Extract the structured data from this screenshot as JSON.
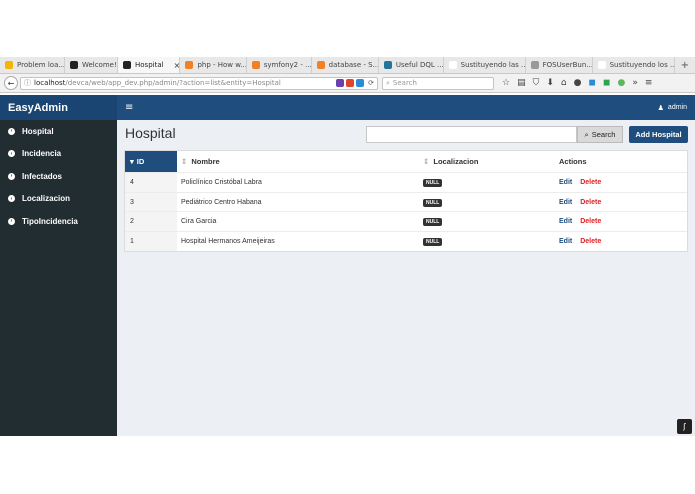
{
  "browser": {
    "tabs": [
      {
        "label": "Problem loa...",
        "color": "#f4b400",
        "active": false
      },
      {
        "label": "Welcome!",
        "color": "#222222",
        "active": false
      },
      {
        "label": "Hospital",
        "color": "#222222",
        "active": true
      },
      {
        "label": "php - How w...",
        "color": "#f48024",
        "active": false
      },
      {
        "label": "symfony2 - ...",
        "color": "#f48024",
        "active": false
      },
      {
        "label": "database - S...",
        "color": "#f48024",
        "active": false
      },
      {
        "label": "Useful DQL ...",
        "color": "#21759b",
        "active": false
      },
      {
        "label": "Sustituyendo las ...",
        "color": "#ffffff",
        "active": false
      },
      {
        "label": "FOSUserBun...",
        "color": "#999999",
        "active": false
      },
      {
        "label": "Sustituyendo los ...",
        "color": "#ffffff",
        "active": false
      }
    ],
    "new_tab": "+",
    "tab_close": "×",
    "url_host": "localhost",
    "url_path": "/devca/web/app_dev.php/admin/?action=list&entity=Hospital",
    "search_placeholder": "Search"
  },
  "header": {
    "logo": "EasyAdmin",
    "toggle": "≡",
    "user": "admin"
  },
  "sidebar": {
    "items": [
      {
        "label": "Hospital"
      },
      {
        "label": "Incidencia"
      },
      {
        "label": "Infectados"
      },
      {
        "label": "Localizacion"
      },
      {
        "label": "TipoIncidencia"
      }
    ]
  },
  "main": {
    "title": "Hospital",
    "search_button": "Search",
    "add_button": "Add Hospital",
    "columns": {
      "id": "ID",
      "nombre": "Nombre",
      "localizacion": "Localizacion",
      "actions": "Actions"
    },
    "rows": [
      {
        "id": "4",
        "nombre": "Policlínico Cristóbal Labra",
        "localizacion": "NULL"
      },
      {
        "id": "3",
        "nombre": "Pediátrico Centro Habana",
        "localizacion": "NULL"
      },
      {
        "id": "2",
        "nombre": "Cira Garcia",
        "localizacion": "NULL"
      },
      {
        "id": "1",
        "nombre": "Hospital Hermanos Ameijeiras",
        "localizacion": "NULL"
      }
    ],
    "edit_label": "Edit",
    "delete_label": "Delete"
  },
  "colors": {
    "brand": "#1f4e7e",
    "sidebar": "#222d32",
    "delete": "#dd2222"
  }
}
